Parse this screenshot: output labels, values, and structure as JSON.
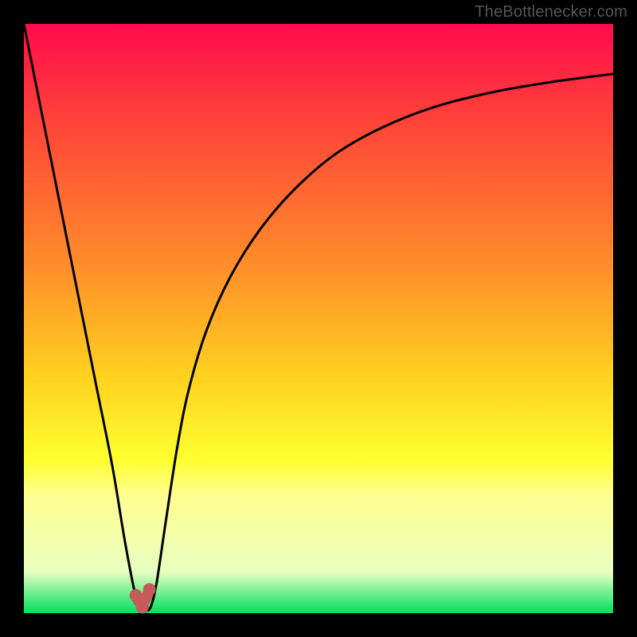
{
  "watermark": "TheBottlenecker.com",
  "chart_data": {
    "type": "line",
    "title": "",
    "xlabel": "",
    "ylabel": "",
    "xlim": [
      0,
      100
    ],
    "ylim": [
      0,
      100
    ],
    "gradient_stops": [
      {
        "offset": 0.0,
        "color": "#ff0a4d"
      },
      {
        "offset": 0.15,
        "color": "#ff3f3a"
      },
      {
        "offset": 0.4,
        "color": "#ff8a2a"
      },
      {
        "offset": 0.6,
        "color": "#ffd21e"
      },
      {
        "offset": 0.74,
        "color": "#ffff30"
      },
      {
        "offset": 0.8,
        "color": "#ffff90"
      },
      {
        "offset": 0.93,
        "color": "#e8ffc0"
      },
      {
        "offset": 1.0,
        "color": "#00e060"
      }
    ],
    "series": [
      {
        "name": "bottleneck-curve",
        "x": [
          0.0,
          3.0,
          6.0,
          9.0,
          12.0,
          15.0,
          17.0,
          18.5,
          19.5,
          20.5,
          21.5,
          22.5,
          24.0,
          26.0,
          28.0,
          31.0,
          35.0,
          40.0,
          46.0,
          53.0,
          61.0,
          70.0,
          80.0,
          90.0,
          100.0
        ],
        "values": [
          100.0,
          85.0,
          70.0,
          55.0,
          40.0,
          25.0,
          13.0,
          5.0,
          1.0,
          0.5,
          1.0,
          5.0,
          15.0,
          28.0,
          38.0,
          48.0,
          57.0,
          65.0,
          72.0,
          78.0,
          82.5,
          86.0,
          88.5,
          90.2,
          91.5
        ]
      }
    ],
    "markers": [
      {
        "name": "left-foot",
        "x": 19.0,
        "y": 3.0,
        "color": "#c55a5a"
      },
      {
        "name": "right-foot",
        "x": 21.3,
        "y": 4.0,
        "color": "#c55a5a"
      },
      {
        "name": "u-bottom",
        "x": 20.1,
        "y": 1.0,
        "color": "#c55a5a"
      }
    ]
  }
}
